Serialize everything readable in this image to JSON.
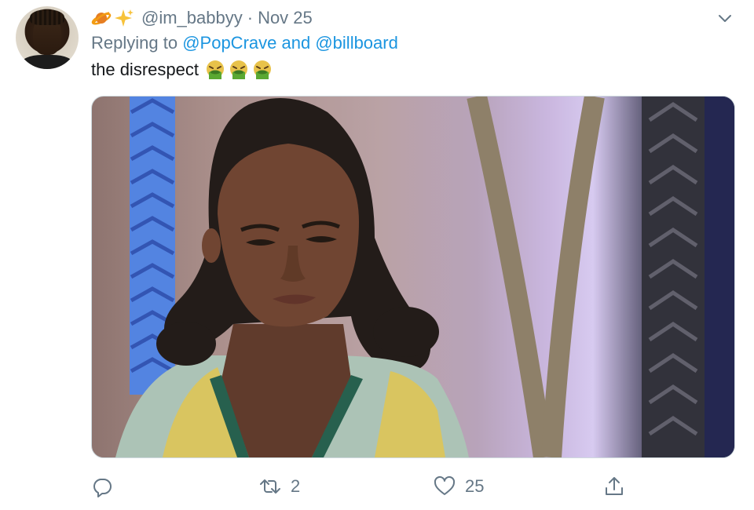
{
  "tweet": {
    "handle": "@im_babbyy",
    "separator": "·",
    "date": "Nov 25",
    "name_emojis": [
      "ringed-planet-emoji",
      "sparkles-emoji"
    ],
    "reply": {
      "prefix": "Replying to",
      "mention1": "@PopCrave",
      "conjunction": "and",
      "mention2": "@billboard"
    },
    "text": "the disrespect",
    "text_emojis": [
      "face-vomiting-emoji",
      "face-vomiting-emoji",
      "face-vomiting-emoji"
    ],
    "media": {
      "alt_kind": "photo"
    },
    "actions": {
      "reply_count": "",
      "retweet_count": "2",
      "like_count": "25",
      "share_count": ""
    }
  },
  "colors": {
    "text_primary": "#14171a",
    "text_secondary": "#657786",
    "link": "#1b95e0",
    "border": "#cfd9de"
  },
  "icons": {
    "more": "chevron-down-icon",
    "reply": "reply-icon",
    "retweet": "retweet-icon",
    "like": "heart-icon",
    "share": "share-icon"
  }
}
